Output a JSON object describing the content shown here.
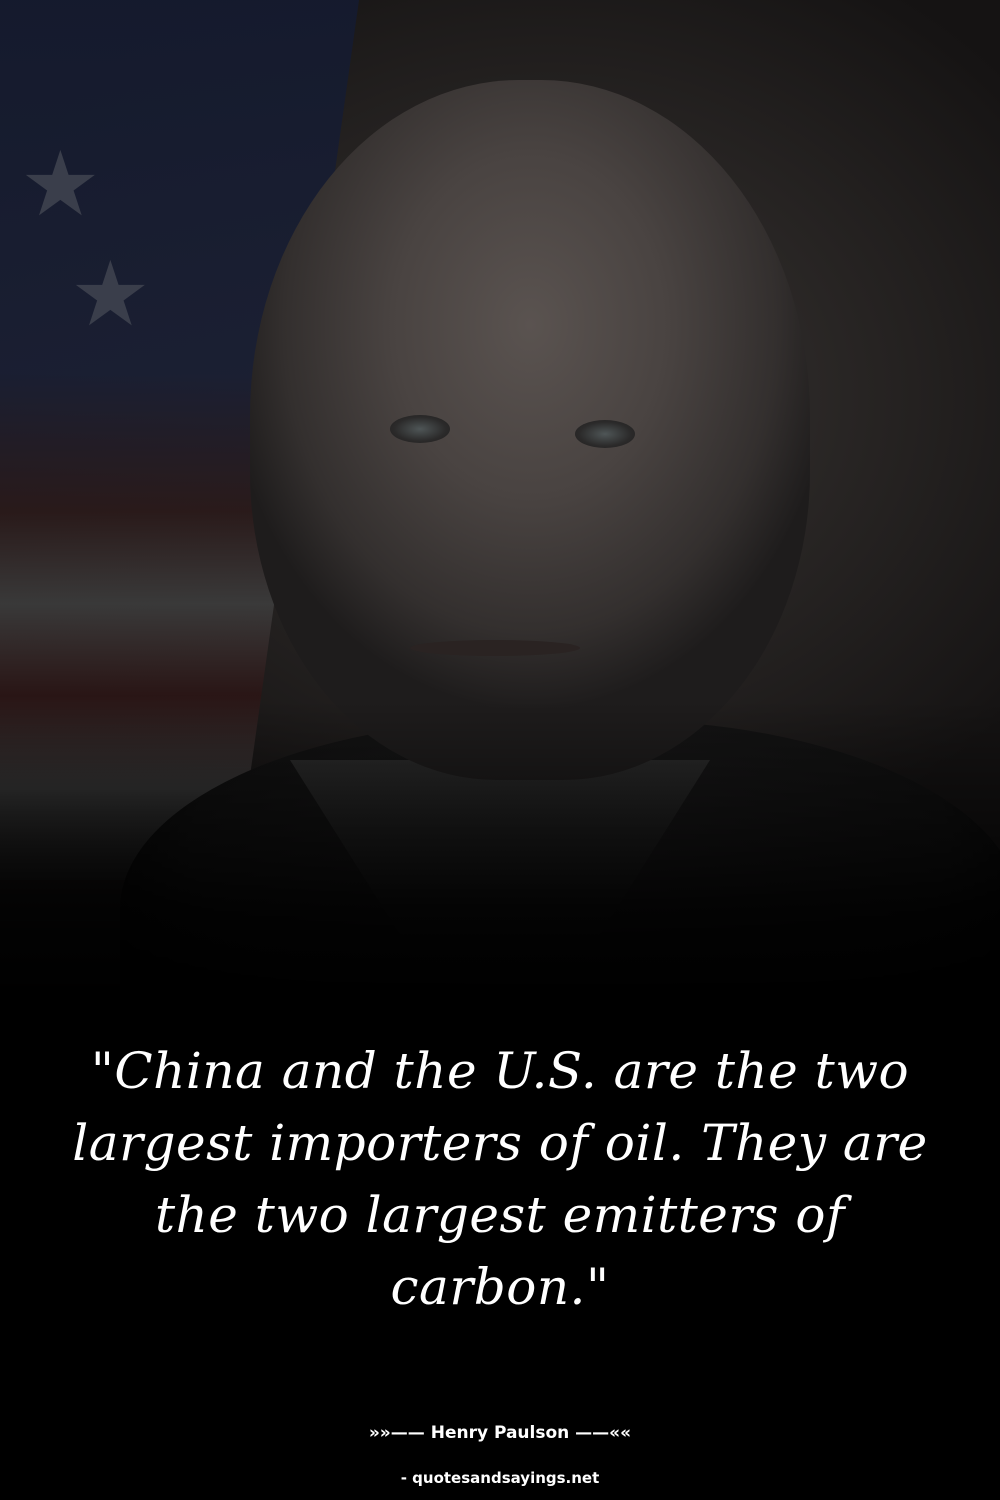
{
  "quote": {
    "text": "\"China and the U.S. are the two largest importers of oil. They are the two largest emitters of carbon.\""
  },
  "author": {
    "line": "»»—— Henry Paulson ——««"
  },
  "source": {
    "site": "- quotesandsayings.net"
  },
  "colors": {
    "background": "#000000",
    "text": "#ffffff"
  }
}
